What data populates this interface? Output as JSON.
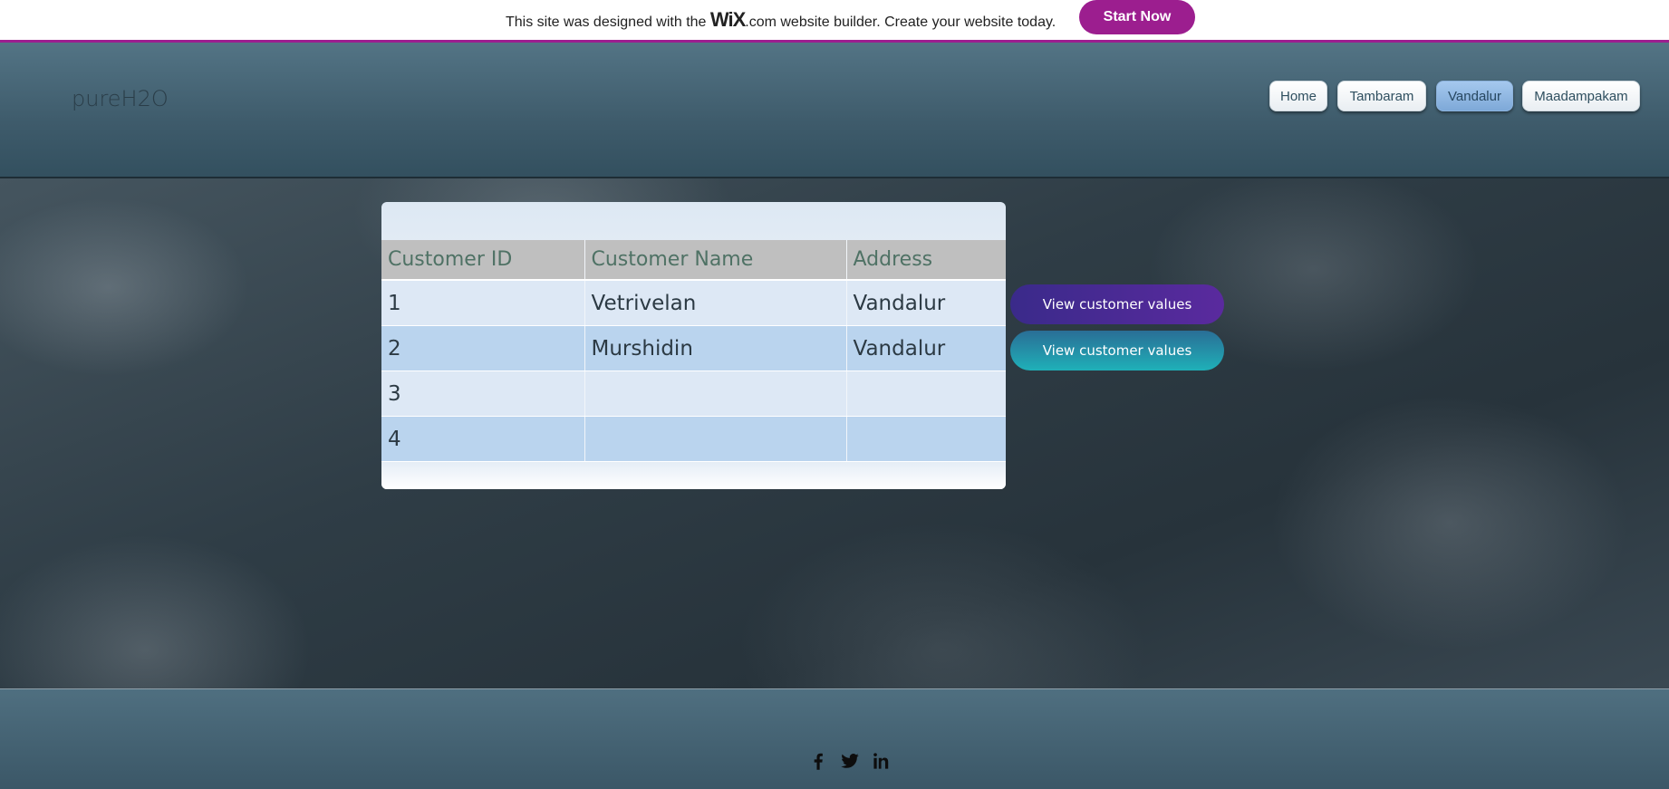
{
  "wix_banner": {
    "text_before": "This site was designed with the ",
    "logo": "WiX",
    "text_after": ".com website builder. Create your website today.",
    "cta_label": "Start Now",
    "accent_color": "#9c1e8f"
  },
  "header": {
    "site_title": "pureH2O",
    "nav": [
      {
        "label": "Home",
        "active": false
      },
      {
        "label": "Tambaram",
        "active": false
      },
      {
        "label": "Vandalur",
        "active": true
      },
      {
        "label": "Maadampakam",
        "active": false
      }
    ]
  },
  "table": {
    "columns": [
      "Customer ID",
      "Customer Name",
      "Address"
    ],
    "rows": [
      [
        "1",
        "Vetrivelan",
        "Vandalur"
      ],
      [
        "2",
        "Murshidin",
        "Vandalur"
      ],
      [
        "3",
        "",
        ""
      ],
      [
        "4",
        "",
        ""
      ]
    ]
  },
  "actions": {
    "view_button_1": "View customer values",
    "view_button_2": "View customer values"
  },
  "footer": {
    "social_icons": [
      "facebook-icon",
      "twitter-icon",
      "linkedin-icon"
    ]
  }
}
